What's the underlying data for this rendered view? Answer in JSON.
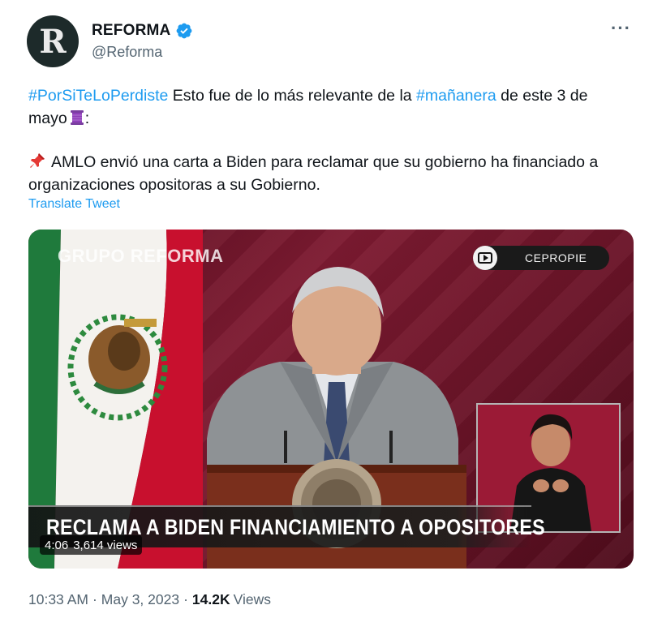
{
  "account": {
    "display_name": "REFORMA",
    "handle": "@Reforma",
    "avatar_letter": "R",
    "verified_icon": "verified-badge-icon",
    "verified_color": "#1d9bf0"
  },
  "more_label": "···",
  "tweet": {
    "hashtag_1": "#PorSiTeLoPerdiste",
    "text_1": " Esto fue de lo más relevante de la ",
    "hashtag_2": "#mañanera",
    "text_2": " de este 3 de mayo",
    "text_3": ":",
    "pin_emoji": "pushpin-icon",
    "spool_emoji": "thread-spool-icon",
    "body": "AMLO envió una carta a Biden para reclamar que su gobierno ha financiado a organizaciones opositoras a su Gobierno."
  },
  "translate_label": "Translate Tweet",
  "video": {
    "watermark": "GRUPO REFORMA",
    "source_badge": "CEPROPIE",
    "caption": "RECLAMA A BIDEN FINANCIAMIENTO A OPOSITORES",
    "duration": "4:06",
    "views": "3,614 views"
  },
  "meta": {
    "time": "10:33 AM",
    "separator": "·",
    "date": "May 3, 2023",
    "view_count": "14.2K",
    "views_label": "Views"
  },
  "colors": {
    "link": "#1d9bf0",
    "secondary_text": "#536471",
    "primary_text": "#0f1419"
  }
}
